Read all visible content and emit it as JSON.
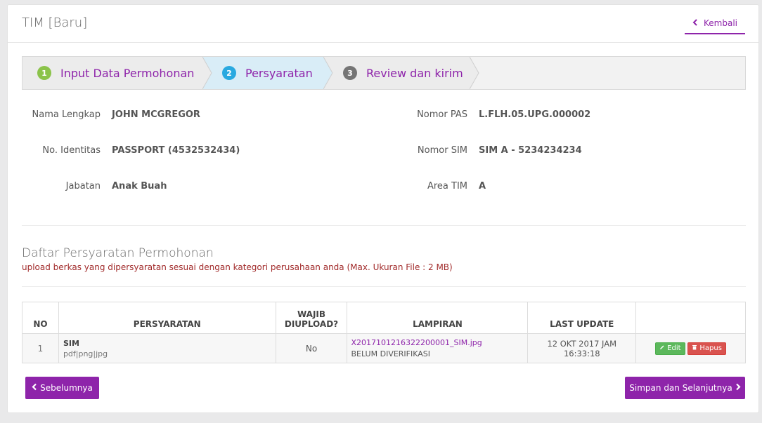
{
  "header": {
    "title": "TIM [Baru]",
    "back_label": "Kembali"
  },
  "steps": [
    {
      "number": "1",
      "label": "Input Data Permohonan",
      "color": "#8bc34a"
    },
    {
      "number": "2",
      "label": "Persyaratan",
      "color": "#29a9e0"
    },
    {
      "number": "3",
      "label": "Review dan kirim",
      "color": "#757575"
    }
  ],
  "info": {
    "nama_label": "Nama Lengkap",
    "nama_value": "JOHN MCGREGOR",
    "identitas_label": "No. Identitas",
    "identitas_value": "PASSPORT (4532532434)",
    "jabatan_label": "Jabatan",
    "jabatan_value": "Anak Buah",
    "pas_label": "Nomor PAS",
    "pas_value": "L.FLH.05.UPG.000002",
    "sim_label": "Nomor SIM",
    "sim_value": "SIM A - 5234234234",
    "area_label": "Area TIM",
    "area_value": "A"
  },
  "section": {
    "title": "Daftar Persyaratan Permohonan",
    "subtitle": "upload berkas yang dipersyaratan sesuai dengan kategori perusahaan anda (Max. Ukuran File : 2 MB)"
  },
  "table": {
    "headers": {
      "no": "NO",
      "persyaratan": "PERSYARATAN",
      "wajib_line1": "WAJIB",
      "wajib_line2": "DIUPLOAD?",
      "lampiran": "LAMPIRAN",
      "last_update": "LAST UPDATE",
      "aksi": ""
    },
    "rows": [
      {
        "no": "1",
        "name": "SIM",
        "types": "pdf|png|jpg",
        "wajib": "No",
        "file": "X2017101216322200001_SIM.jpg",
        "status": "BELUM DIVERIFIKASI",
        "last_update": "12 OKT 2017 JAM 16:33:18",
        "edit_label": "Edit",
        "delete_label": "Hapus"
      }
    ]
  },
  "footer": {
    "prev_label": "Sebelumnya",
    "next_label": "Simpan dan Selanjutnya"
  },
  "colors": {
    "accent": "#8e24aa",
    "step_active_bg": "#d9edf7",
    "edit": "#5cb85c",
    "delete": "#d9534f",
    "subtitle": "#a12a2a"
  }
}
